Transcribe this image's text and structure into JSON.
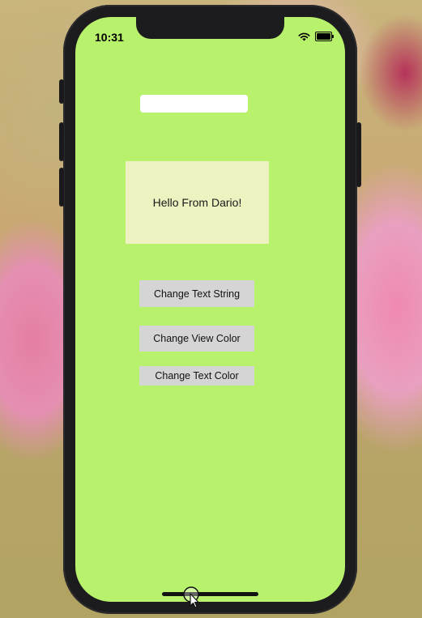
{
  "status_bar": {
    "time": "10:31"
  },
  "text_field": {
    "value": "",
    "placeholder": ""
  },
  "hello_view": {
    "label": "Hello From Dario!"
  },
  "buttons": {
    "change_text_string": "Change Text String",
    "change_view_color": "Change View Color",
    "change_text_color": "Change Text Color"
  },
  "colors": {
    "screen_background": "#b8f16c",
    "hello_view_background": "#eef2c1",
    "button_background": "#d5d5d6",
    "device_frame": "#1c1c1e"
  },
  "icons": {
    "status": [
      "wifi-icon",
      "battery-icon"
    ],
    "pointer": "cursor-icon"
  }
}
